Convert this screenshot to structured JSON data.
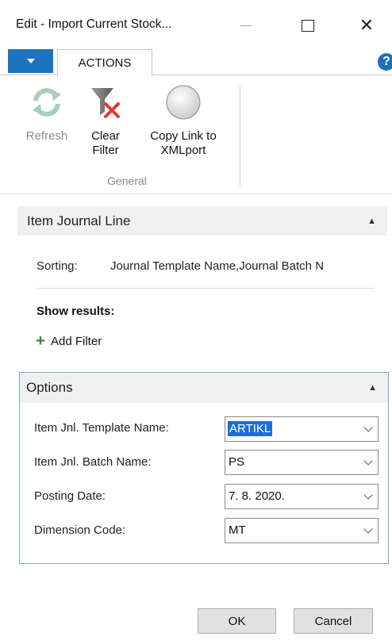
{
  "window": {
    "title": "Edit - Import Current Stock..."
  },
  "ribbon": {
    "tab_label": "ACTIONS",
    "buttons": {
      "refresh": "Refresh",
      "clear_filter_line1": "Clear",
      "clear_filter_line2": "Filter",
      "copy_link_line1": "Copy Link to",
      "copy_link_line2": "XMLport"
    },
    "group_label": "General"
  },
  "item_journal_line": {
    "title": "Item Journal Line",
    "sorting_label": "Sorting:",
    "sorting_value": "Journal Template Name,Journal Batch N",
    "show_results": "Show results:",
    "add_filter": "Add Filter"
  },
  "options": {
    "title": "Options",
    "fields": [
      {
        "label": "Item Jnl. Template Name:",
        "value": "ARTIKL"
      },
      {
        "label": "Item Jnl. Batch Name:",
        "value": "PS"
      },
      {
        "label": "Posting Date:",
        "value": "7. 8. 2020."
      },
      {
        "label": "Dimension Code:",
        "value": "MT"
      }
    ]
  },
  "footer": {
    "ok_label": "OK",
    "cancel_label": "Cancel"
  },
  "colors": {
    "accent": "#1e73be",
    "selection": "#1e6ed8",
    "options_border": "#7aa7d8"
  }
}
